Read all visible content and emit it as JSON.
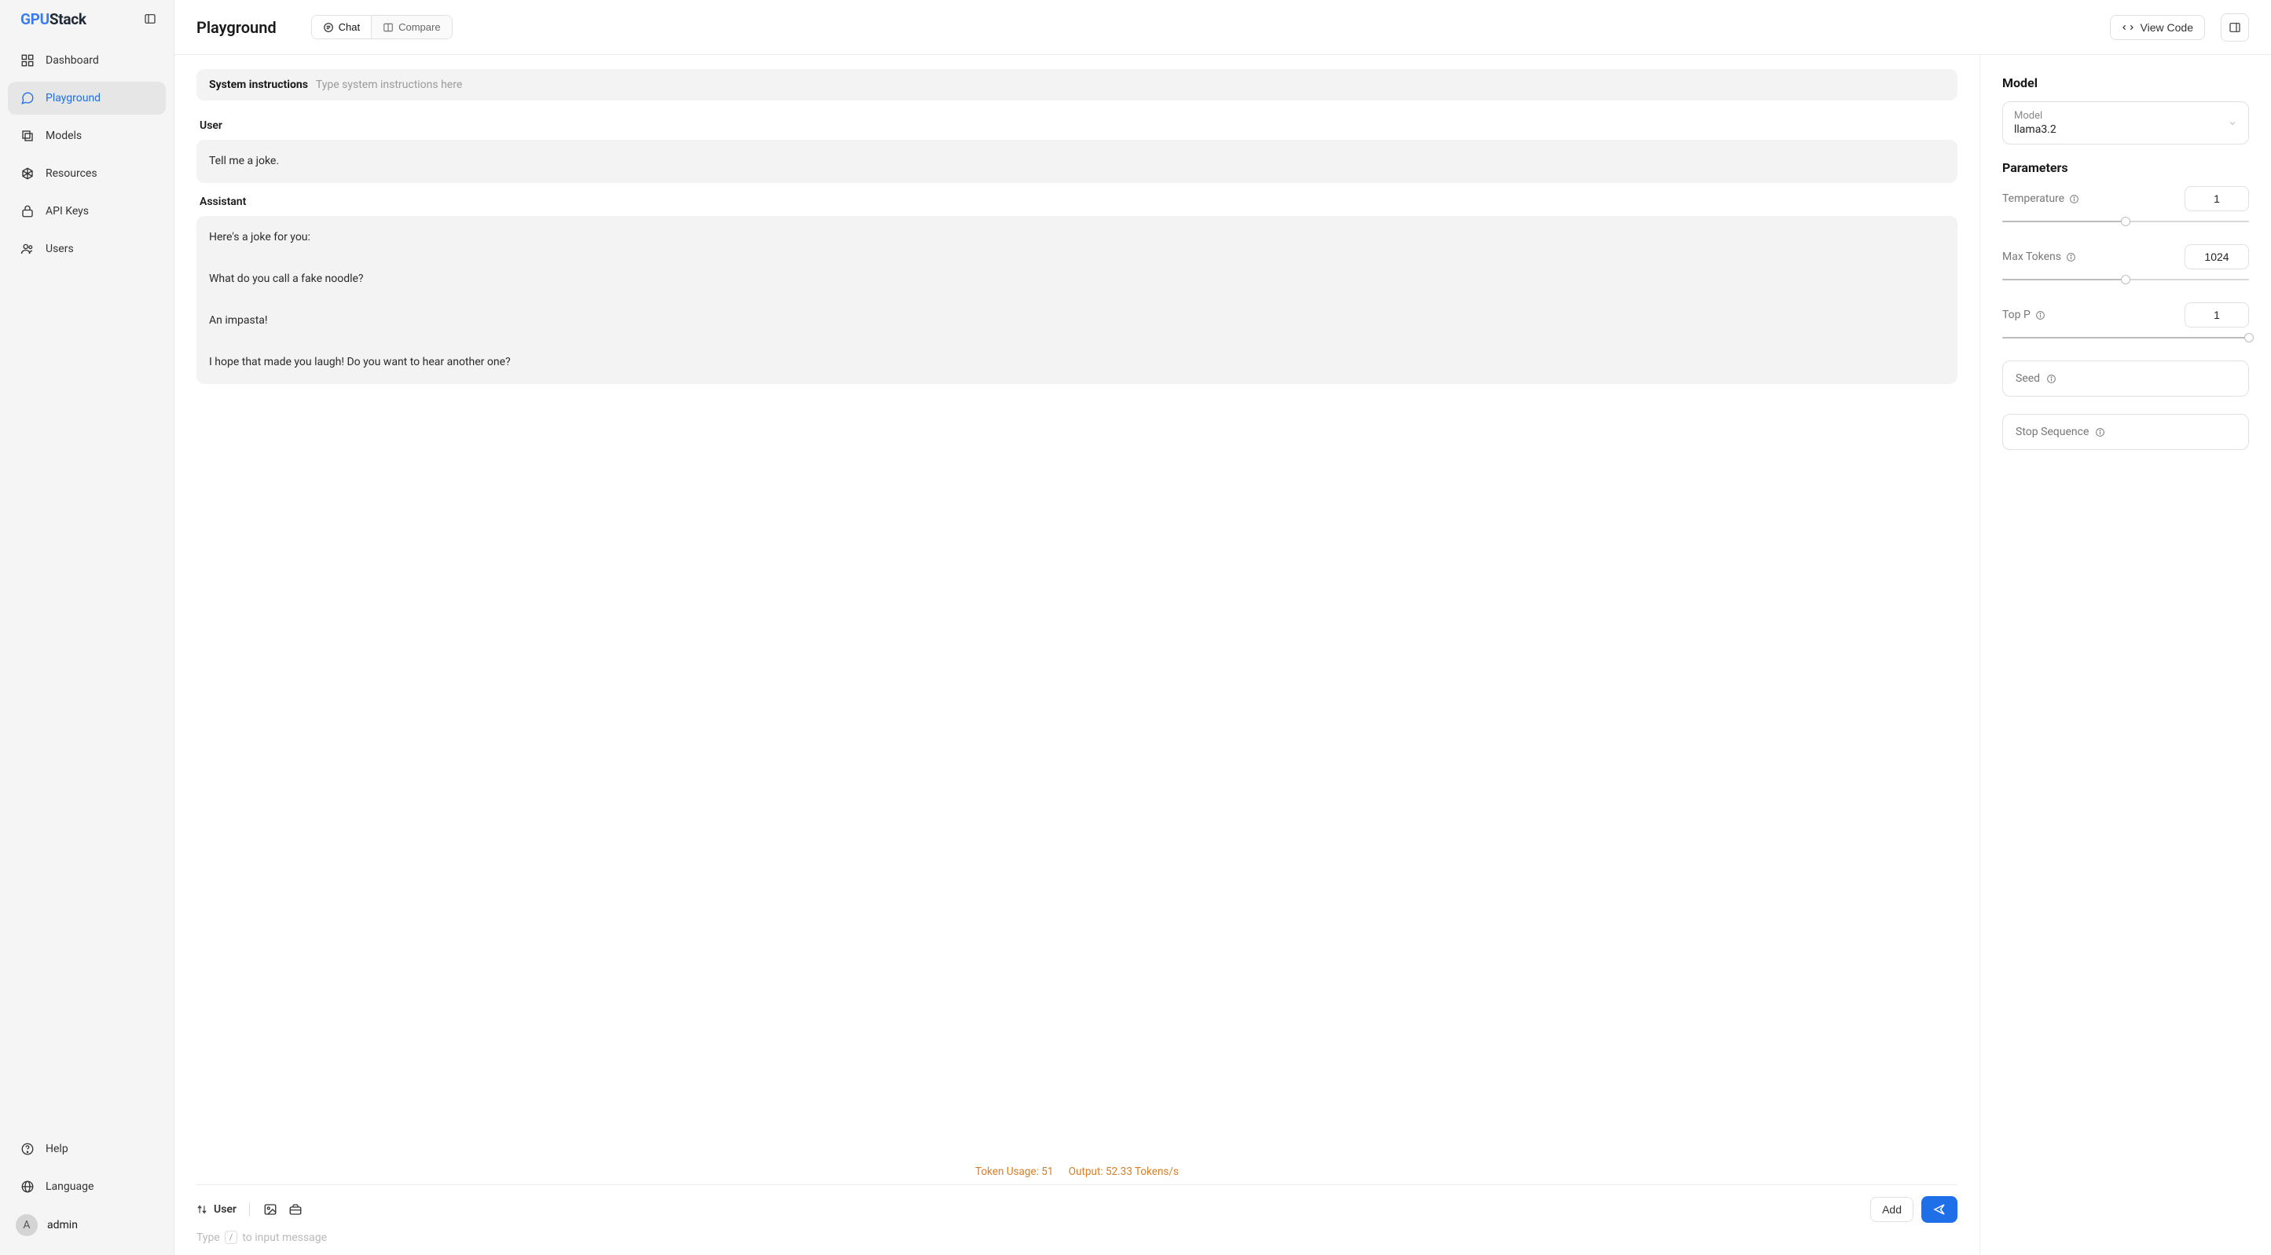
{
  "brand": {
    "prefix": "GPU",
    "suffix": "Stack"
  },
  "nav": {
    "dashboard": "Dashboard",
    "playground": "Playground",
    "models": "Models",
    "resources": "Resources",
    "apikeys": "API Keys",
    "users": "Users"
  },
  "footer": {
    "help": "Help",
    "language": "Language",
    "user_initial": "A",
    "user_name": "admin"
  },
  "header": {
    "title": "Playground",
    "chat": "Chat",
    "compare": "Compare",
    "view_code": "View Code"
  },
  "system": {
    "label": "System instructions",
    "placeholder": "Type system instructions here"
  },
  "chat": {
    "user_role": "User",
    "assistant_role": "Assistant",
    "user_msg": "Tell me a joke.",
    "assistant_msg": "Here's a joke for you:\n\nWhat do you call a fake noodle?\n\nAn impasta!\n\nI hope that made you laugh! Do you want to hear another one?"
  },
  "stats": {
    "token_usage": "Token Usage: 51",
    "output": "Output: 52.33 Tokens/s"
  },
  "composer": {
    "role": "User",
    "add": "Add",
    "hint_pre": "Type",
    "hint_key": "/",
    "hint_post": "to input message"
  },
  "model": {
    "section": "Model",
    "label": "Model",
    "value": "llama3.2"
  },
  "params": {
    "section": "Parameters",
    "temperature": {
      "label": "Temperature",
      "value": "1",
      "pct": 50
    },
    "max_tokens": {
      "label": "Max Tokens",
      "value": "1024",
      "pct": 50
    },
    "top_p": {
      "label": "Top P",
      "value": "1",
      "pct": 100
    },
    "seed": {
      "label": "Seed"
    },
    "stop": {
      "label": "Stop Sequence"
    }
  }
}
